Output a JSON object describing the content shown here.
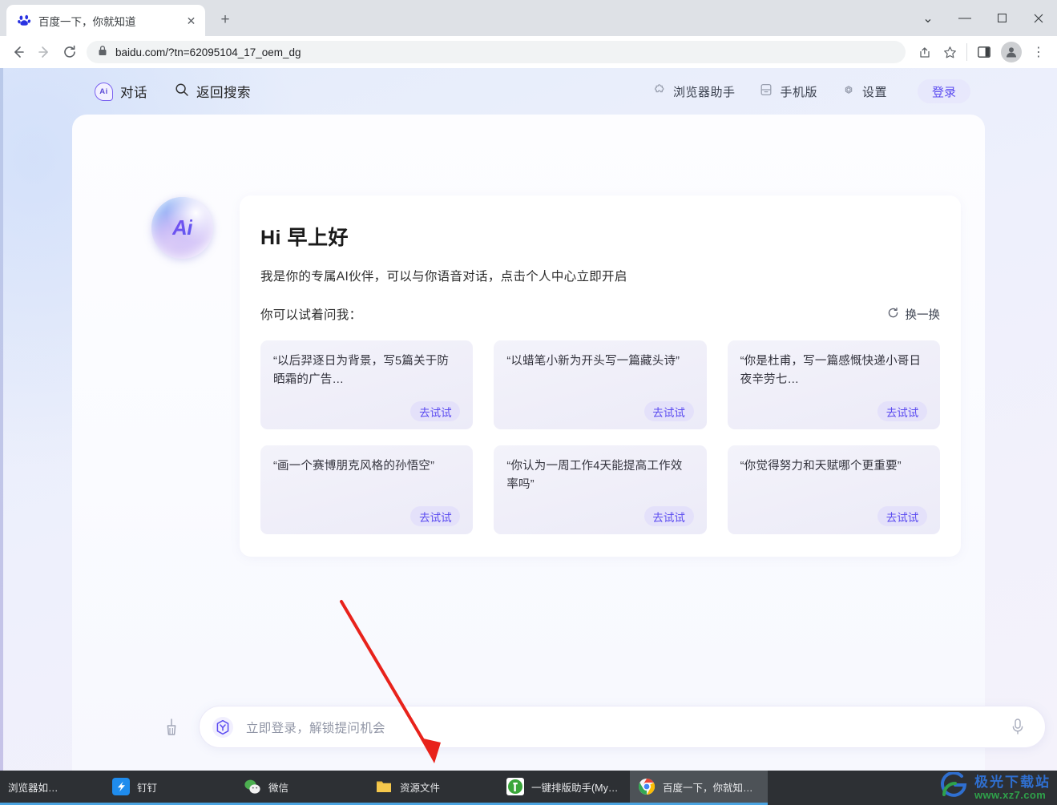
{
  "browser": {
    "tab": {
      "title": "百度一下，你就知道",
      "favicon": "baidu-paw-icon",
      "close": "✕"
    },
    "newtab_label": "+",
    "window_controls": {
      "chevron": "⌄",
      "minimize": "—",
      "maximize": "☐",
      "close": "✕"
    },
    "toolbar": {
      "back": "←",
      "forward": "→",
      "reload": "⟳",
      "lock": "lock-icon",
      "url": "baidu.com/?tn=62095104_17_oem_dg",
      "share": "share-icon",
      "bookmark": "★",
      "sidepanel": "side-panel-icon",
      "profile": "profile-avatar",
      "menu": "⋮"
    }
  },
  "sitenav": {
    "left": [
      {
        "icon": "ai-chip-icon",
        "label": "对话"
      },
      {
        "icon": "search-icon",
        "label": "返回搜索"
      }
    ],
    "right": [
      {
        "icon": "puzzle-icon",
        "label": "浏览器助手"
      },
      {
        "icon": "mobile-icon",
        "label": "手机版"
      },
      {
        "icon": "gear-icon",
        "label": "设置"
      }
    ],
    "login_label": "登录"
  },
  "main": {
    "avatar_text": "Ai",
    "greeting_title": "Hi 早上好",
    "greeting_sub": "我是你的专属AI伙伴，可以与你语音对话，点击个人中心立即开启",
    "try_label": "你可以试着问我：",
    "refresh_label": "换一换",
    "refresh_icon": "refresh-icon",
    "cards": [
      {
        "text": "“以后羿逐日为背景，写5篇关于防晒霜的广告…",
        "button": "去试试"
      },
      {
        "text": "“以蜡笔小新为开头写一篇藏头诗”",
        "button": "去试试"
      },
      {
        "text": "“你是杜甫，写一篇感慨快递小哥日夜辛劳七…",
        "button": "去试试"
      },
      {
        "text": "“画一个赛博朋克风格的孙悟空”",
        "button": "去试试"
      },
      {
        "text": "“你认为一周工作4天能提高工作效率吗”",
        "button": "去试试"
      },
      {
        "text": "“你觉得努力和天赋哪个更重要”",
        "button": "去试试"
      }
    ]
  },
  "input_dock": {
    "clear_icon": "broom-icon",
    "badge_icon": "hex-badge-icon",
    "placeholder": "立即登录，解锁提问机会",
    "mic_icon": "microphone-icon"
  },
  "taskbar": {
    "items": [
      {
        "label": "浏览器如…",
        "icon": "browser-icon",
        "active": false
      },
      {
        "label": "钉钉",
        "icon": "dingtalk-icon",
        "active": false
      },
      {
        "label": "微信",
        "icon": "wechat-icon",
        "active": false
      },
      {
        "label": "资源文件",
        "icon": "folder-icon",
        "active": false
      },
      {
        "label": "一键排版助手(MyE…",
        "icon": "typesetting-icon",
        "active": false
      },
      {
        "label": "百度一下，你就知…",
        "icon": "chrome-icon",
        "active": true
      }
    ],
    "watermark": {
      "top": "极光下载站",
      "bottom": "www.xz7.com"
    }
  },
  "colors": {
    "accent_purple": "#5b4bf0",
    "page_bg": "#e9eefb",
    "taskbar": "#2d3034",
    "annotation_red": "#e8221b"
  }
}
